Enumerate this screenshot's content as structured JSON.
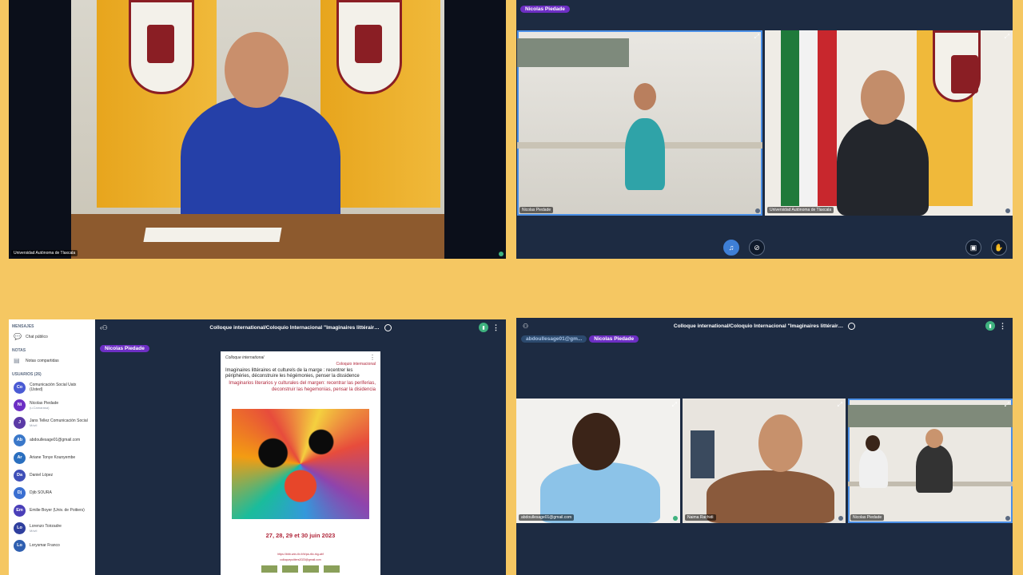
{
  "panel1": {
    "name_tag": "Universidad Autónoma de Tlaxcala"
  },
  "panel2": {
    "presenter_badge": "Nicolas Piedade",
    "tiles": [
      {
        "name": "Nicolas Piedade"
      },
      {
        "name": "Universidad Autónoma de Tlaxcala"
      }
    ],
    "controls": {
      "audio_icon": "headphones-icon",
      "video_icon": "camera-off-icon",
      "screen_icon": "screen-share-icon",
      "hand_icon": "raise-hand-icon"
    }
  },
  "panel3": {
    "sidebar": {
      "messages_header": "MENSAJES",
      "public_chat": "Chat público",
      "notes_header": "NOTAS",
      "shared_notes": "Notas compartidas",
      "users_header": "USUARIOS (26)",
      "users": [
        {
          "initials": "Co",
          "name": "Comunicación Social Uatx (Usted)",
          "sub": "",
          "color": "#4a5bd4"
        },
        {
          "initials": "Ni",
          "name": "Nicolas Piedade",
          "sub": "(u.Camarasa)",
          "color": "#6d2fc4"
        },
        {
          "initials": "J",
          "name": "Jans Tellez Comunicación Social",
          "sub": "Móvil",
          "color": "#5b3aa6"
        },
        {
          "initials": "Ab",
          "name": "abdoullesage01@gmail.com",
          "sub": "",
          "color": "#3a78c9"
        },
        {
          "initials": "Ar",
          "name": "Ariane Tonye Kounyembe",
          "sub": "",
          "color": "#2a6fbf"
        },
        {
          "initials": "Da",
          "name": "Daniel López",
          "sub": "",
          "color": "#3f4fb8"
        },
        {
          "initials": "Dj",
          "name": "Djib SOURA",
          "sub": "",
          "color": "#3a6fd1"
        },
        {
          "initials": "Em",
          "name": "Emilie Boyer (Univ. de Poitiers)",
          "sub": "",
          "color": "#4a3fb8"
        },
        {
          "initials": "Lo",
          "name": "Lorenzo Toirzadre",
          "sub": "Móvil",
          "color": "#2f3f9e"
        },
        {
          "initials": "Lo",
          "name": "Lorysmar Franco",
          "sub": "",
          "color": "#2f5fb0"
        }
      ]
    },
    "title": "Colloque international/Coloquio Internacional \"Imaginaires littérair…",
    "presenter_badge": "Nicolas Piedade",
    "poster": {
      "line1": "Colloque international",
      "line2": "Coloquio internacional",
      "title_fr": "Imaginaires littéraires et culturels de la marge : recentrer les périphéries, déconstruire les hégémonies, penser la dissidence",
      "title_es": "Imaginarios literarios y culturales del margen: recentrar las periferias, deconstruir las hegemonías, pensar la disidencia",
      "dates": "27, 28, 29 et 30 juin 2023",
      "link": "https://bbb.univ-tlx.fr/b/pa-r6x-rkg-abf",
      "email": "colloquepoitiers2023@gmail.com"
    }
  },
  "panel4": {
    "title": "Colloque international/Coloquio Internacional \"Imaginaires littérair…",
    "badge_mail": "abdoullesage01@gm...",
    "presenter_badge": "Nicolas Piedade",
    "tiles": [
      {
        "name": "abdoullesage01@gmail.com"
      },
      {
        "name": "Naima Rachidi"
      },
      {
        "name": "Nicolas Piedade"
      }
    ]
  }
}
